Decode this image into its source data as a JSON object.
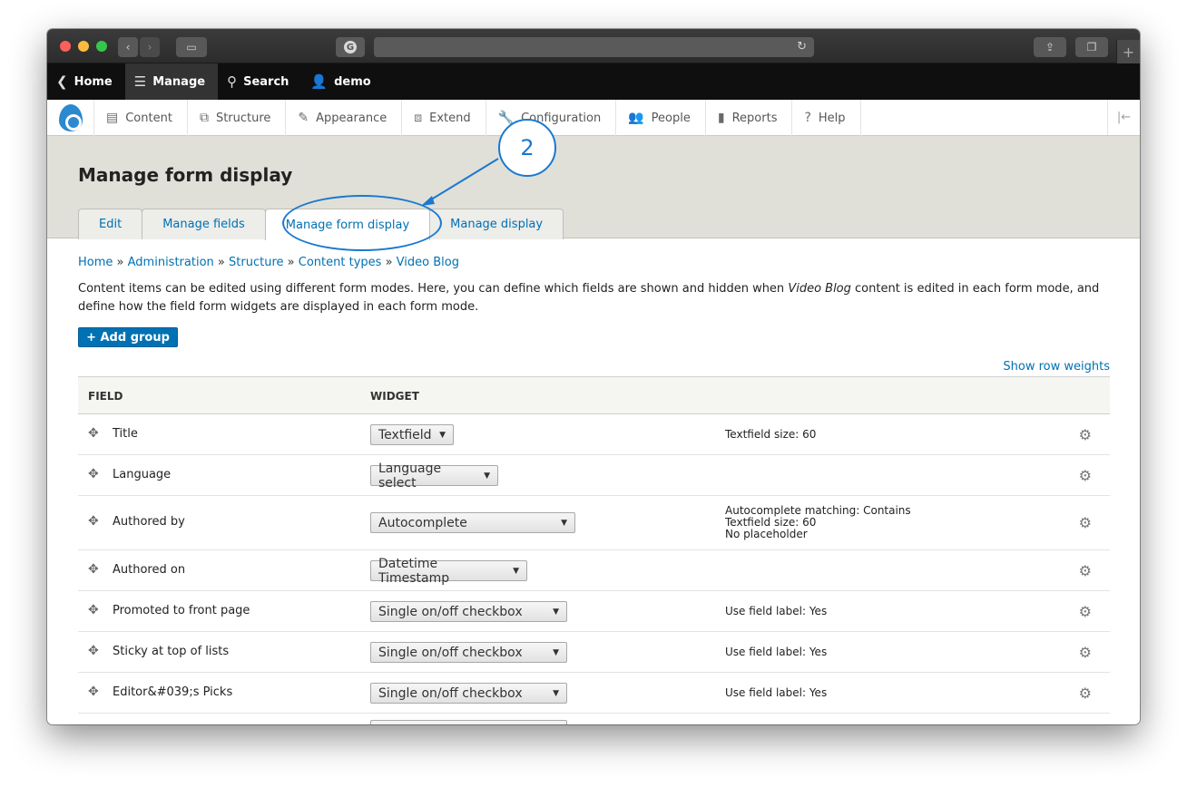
{
  "browser": {
    "tab_plus": "+"
  },
  "admin_bar": {
    "items": [
      {
        "label": "Home",
        "icon": "chevron-circle-icon"
      },
      {
        "label": "Manage",
        "icon": "hamburger-icon"
      },
      {
        "label": "Search",
        "icon": "search-icon"
      },
      {
        "label": "demo",
        "icon": "user-icon"
      }
    ]
  },
  "tray": {
    "items": [
      {
        "label": "Content",
        "icon": "document-icon"
      },
      {
        "label": "Structure",
        "icon": "structure-icon"
      },
      {
        "label": "Appearance",
        "icon": "paint-icon"
      },
      {
        "label": "Extend",
        "icon": "puzzle-icon"
      },
      {
        "label": "Configuration",
        "icon": "wrench-icon"
      },
      {
        "label": "People",
        "icon": "people-icon"
      },
      {
        "label": "Reports",
        "icon": "bar-chart-icon"
      },
      {
        "label": "Help",
        "icon": "help-icon"
      }
    ]
  },
  "header": {
    "title": "Manage form display",
    "tabs": [
      {
        "label": "Edit"
      },
      {
        "label": "Manage fields"
      },
      {
        "label": "Manage form display"
      },
      {
        "label": "Manage display"
      }
    ]
  },
  "annotation": {
    "number": "2"
  },
  "breadcrumb": {
    "items": [
      "Home",
      "Administration",
      "Structure",
      "Content types",
      "Video Blog"
    ],
    "separator": "»"
  },
  "description": {
    "before": "Content items can be edited using different form modes. Here, you can define which fields are shown and hidden when ",
    "emphasis": "Video Blog",
    "after": " content is edited in each form mode, and define how the field form widgets are displayed in each form mode."
  },
  "actions": {
    "add_group": "+ Add group",
    "show_row_weights": "Show row weights"
  },
  "table": {
    "headers": {
      "field": "FIELD",
      "widget": "WIDGET"
    },
    "rows": [
      {
        "field": "Title",
        "widget": "Textfield",
        "summary": [
          "Textfield size: 60"
        ]
      },
      {
        "field": "Language",
        "widget": "Language select",
        "summary": []
      },
      {
        "field": "Authored by",
        "widget": "Autocomplete",
        "summary": [
          "Autocomplete matching: Contains",
          "Textfield size: 60",
          "No placeholder"
        ]
      },
      {
        "field": "Authored on",
        "widget": "Datetime Timestamp",
        "summary": []
      },
      {
        "field": "Promoted to front page",
        "widget": "Single on/off checkbox",
        "summary": [
          "Use field label: Yes"
        ]
      },
      {
        "field": "Sticky at top of lists",
        "widget": "Single on/off checkbox",
        "summary": [
          "Use field label: Yes"
        ]
      },
      {
        "field": "Editor&#039;s Picks",
        "widget": "Single on/off checkbox",
        "summary": [
          "Use field label: Yes"
        ]
      }
    ]
  },
  "colors": {
    "link": "#0071b3",
    "annotation": "#1b78d0",
    "header_bg": "#e0e0d8"
  }
}
